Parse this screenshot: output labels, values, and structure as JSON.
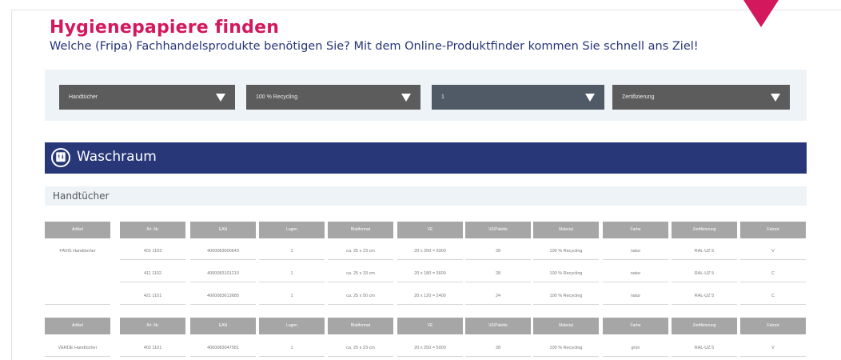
{
  "header": {
    "title": "Hygienepapiere finden",
    "subtitle": "Welche (Fripa) Fachhandelsprodukte benötigen Sie? Mit dem Online-Produktfinder kommen Sie schnell ans Ziel!"
  },
  "filters": [
    {
      "label": "Handtücher"
    },
    {
      "label": "100 % Recycling"
    },
    {
      "label": "1"
    },
    {
      "label": "Zertifizierung"
    }
  ],
  "section": {
    "icon": "restroom-icon",
    "title": "Waschraum"
  },
  "subsection": {
    "title": "Handtücher"
  },
  "table": {
    "columns": [
      "Artikel",
      "Art.-Nr.",
      "EAN",
      "Lagen",
      "Blattformat",
      "VE",
      "VE/Palette",
      "Material",
      "Farbe",
      "Zertifizierung",
      "Falzart"
    ],
    "groups": [
      {
        "rows": [
          [
            "FAVIS Handtücher",
            "401 1103",
            "4000083000643",
            "1",
            "ca. 25 x 23 cm",
            "20 x 250 = 5000",
            "28",
            "100 % Recycling",
            "natur",
            "RAL-UZ 5",
            "V"
          ],
          [
            "",
            "411 1102",
            "4000083101210",
            "1",
            "ca. 25 x 33 cm",
            "20 x 180 = 3600",
            "28",
            "100 % Recycling",
            "natur",
            "RAL-UZ 5",
            "C"
          ],
          [
            "",
            "421 1101",
            "4000083613685",
            "1",
            "ca. 25 x 50 cm",
            "20 x 120 = 2400",
            "24",
            "100 % Recycling",
            "natur",
            "RAL-UZ 5",
            "C"
          ]
        ]
      },
      {
        "rows": [
          [
            "VERDE Handtücher",
            "402 1101",
            "4000083047581",
            "1",
            "ca. 25 x 23 cm",
            "20 x 250 = 5000",
            "28",
            "100 % Recycling",
            "grün",
            "RAL-UZ 5",
            "V"
          ]
        ]
      }
    ]
  },
  "colors": {
    "title": "#d4185e",
    "subtitle": "#253478",
    "section_bar": "#283777",
    "filter_bg": "#5c5c5c",
    "table_header": "#a6a6a6"
  }
}
